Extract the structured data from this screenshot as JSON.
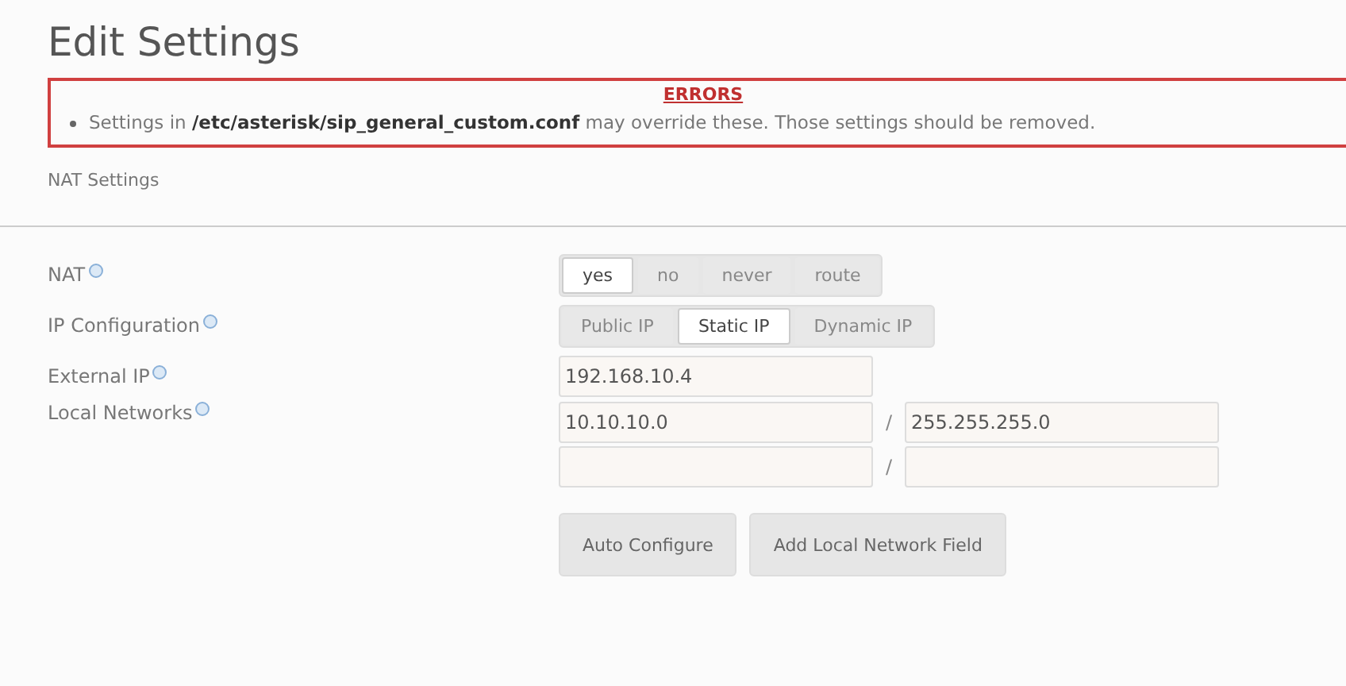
{
  "page": {
    "title": "Edit Settings"
  },
  "errors": {
    "title": "ERRORS",
    "items": [
      "Settings in **/etc/asterisk/sip_general_custom.conf** may override these. Those settings should be removed."
    ]
  },
  "section": {
    "title": "NAT Settings"
  },
  "fields": [
    {
      "kind": "segmented",
      "label": "NAT",
      "options": [
        {
          "label": "yes",
          "selected": true
        },
        {
          "label": "no",
          "selected": false
        },
        {
          "label": "never",
          "selected": false
        },
        {
          "label": "route",
          "selected": false
        }
      ]
    },
    {
      "kind": "segmented",
      "label": "IP Configuration",
      "options": [
        {
          "label": "Public IP",
          "selected": false
        },
        {
          "label": "Static IP",
          "selected": true
        },
        {
          "label": "Dynamic IP",
          "selected": false
        }
      ]
    },
    {
      "kind": "text",
      "label": "External IP",
      "value": "192.168.10.4"
    },
    {
      "kind": "networks",
      "label": "Local Networks",
      "rows": [
        {
          "network": "10.10.10.0",
          "separator": "/",
          "mask": "255.255.255.0"
        },
        {
          "network": "",
          "separator": "/",
          "mask": ""
        }
      ]
    }
  ],
  "buttons": [
    "Auto Configure",
    "Add Local Network Field"
  ]
}
